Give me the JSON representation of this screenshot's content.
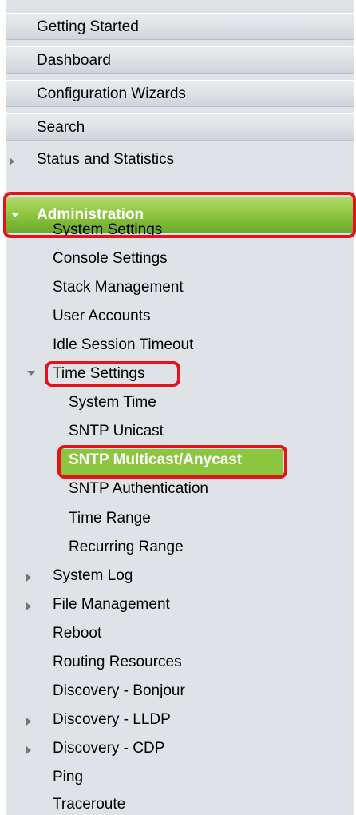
{
  "top_items": [
    "Getting Started",
    "Dashboard",
    "Configuration Wizards",
    "Search"
  ],
  "status_and_statistics": "Status and Statistics",
  "administration": {
    "label": "Administration",
    "children": [
      "System Settings",
      "Console Settings",
      "Stack Management",
      "User Accounts",
      "Idle Session Timeout"
    ],
    "time_settings": {
      "label": "Time Settings",
      "children": [
        "System Time",
        "SNTP Unicast",
        "SNTP Multicast/Anycast",
        "SNTP Authentication",
        "Time Range",
        "Recurring Range"
      ],
      "selected": "SNTP Multicast/Anycast"
    },
    "after": [
      "System Log",
      "File Management",
      "Reboot",
      "Routing Resources",
      "Discovery - Bonjour",
      "Discovery - LLDP",
      "Discovery - CDP",
      "Ping",
      "Traceroute"
    ]
  },
  "colors": {
    "selected_green": "#8cc63f",
    "highlight_red": "#e3131b",
    "nav_background": "#dfe3e8"
  }
}
